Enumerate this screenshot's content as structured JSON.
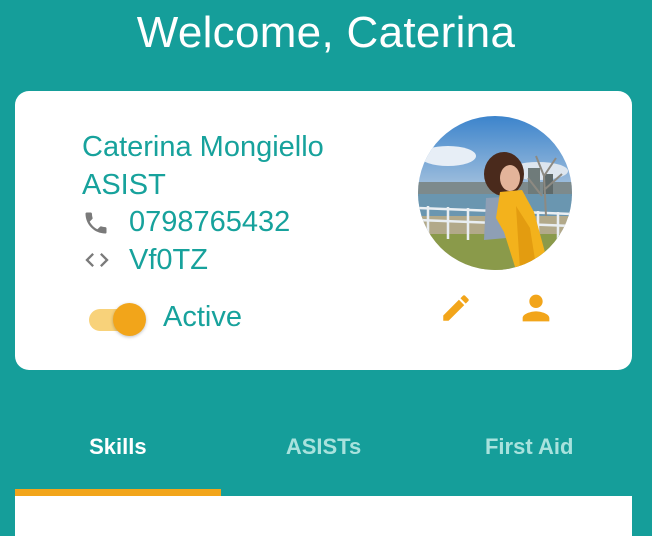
{
  "header": {
    "title": "Welcome, Caterina"
  },
  "profile": {
    "name": "Caterina Mongiello",
    "role": "ASIST",
    "phone": "0798765432",
    "code": "Vf0TZ",
    "status_label": "Active",
    "active": true
  },
  "icons": {
    "phone": "phone-icon",
    "code": "code-icon",
    "edit": "pencil-icon",
    "profile": "person-icon"
  },
  "tabs": [
    {
      "label": "Skills",
      "active": true
    },
    {
      "label": "ASISTs",
      "active": false
    },
    {
      "label": "First Aid",
      "active": false
    }
  ],
  "colors": {
    "background": "#159e9a",
    "accent": "#f2a51a",
    "text_teal": "#17a29c",
    "card": "#ffffff"
  }
}
